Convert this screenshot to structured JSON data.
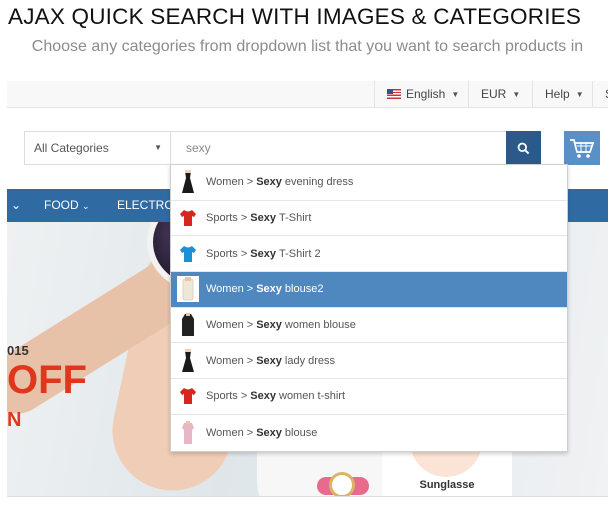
{
  "page": {
    "title": "AJAX QUICK SEARCH WITH IMAGES & CATEGORIES",
    "subtitle": "Choose any categories from dropdown list that you want to search products in"
  },
  "topbar": {
    "language": "English",
    "currency": "EUR",
    "help": "Help",
    "cut_item": "S"
  },
  "search": {
    "category_selected": "All Categories",
    "query": "sexy"
  },
  "nav": {
    "items": [
      "FOOD",
      "ELECTRO"
    ]
  },
  "banner": {
    "year": "015",
    "promo": "OFF",
    "promo_sub": "N",
    "product_label": "Sunglasse"
  },
  "suggestions": [
    {
      "category": "Women",
      "separator": ">",
      "match": "Sexy",
      "rest": "evening dress",
      "icon": "black-dress-icon",
      "active": false
    },
    {
      "category": "Sports",
      "separator": ">",
      "match": "Sexy",
      "rest": "T-Shirt",
      "icon": "red-tshirt-icon",
      "active": false
    },
    {
      "category": "Sports",
      "separator": ">",
      "match": "Sexy",
      "rest": "T-Shirt 2",
      "icon": "blue-tshirt-icon",
      "active": false
    },
    {
      "category": "Women",
      "separator": ">",
      "match": "Sexy",
      "rest": "blouse2",
      "icon": "white-blouse-icon",
      "active": true
    },
    {
      "category": "Women",
      "separator": ">",
      "match": "Sexy",
      "rest": "women blouse",
      "icon": "black-blouse-icon",
      "active": false
    },
    {
      "category": "Women",
      "separator": ">",
      "match": "Sexy",
      "rest": "lady dress",
      "icon": "black-dress-icon",
      "active": false
    },
    {
      "category": "Sports",
      "separator": ">",
      "match": "Sexy",
      "rest": "women t-shirt",
      "icon": "red-tshirt-icon",
      "active": false
    },
    {
      "category": "Women",
      "separator": ">",
      "match": "Sexy",
      "rest": "blouse",
      "icon": "pink-blouse-icon",
      "active": false
    }
  ],
  "colors": {
    "nav_bg": "#2f6aa2",
    "search_button": "#2b5a8a",
    "cart_button": "#5b90c6",
    "active_row": "#4f87bf",
    "promo_red": "#e0371c"
  }
}
